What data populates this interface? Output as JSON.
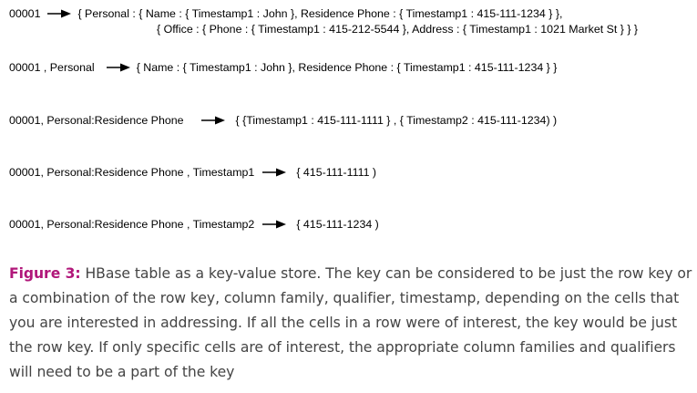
{
  "rows": [
    {
      "key": "00001",
      "value_line1": "{ Personal : { Name : { Timestamp1 : John }, Residence Phone : { Timestamp1 : 415-111-1234 } },",
      "value_line2": "{ Office : { Phone : { Timestamp1 : 415-212-5544 }, Address : { Timestamp1 : 1021 Market St } } }"
    },
    {
      "key": "00001 , Personal",
      "value_line1": "{ Name : { Timestamp1 : John }, Residence Phone : { Timestamp1 : 415-111-1234 } }"
    },
    {
      "key": "00001, Personal:Residence Phone",
      "value_line1": "{ {Timestamp1 : 415-111-1111 } , { Timestamp2 : 415-111-1234) )"
    },
    {
      "key": "00001, Personal:Residence Phone , Timestamp1",
      "value_line1": "{ 415-111-1111 )"
    },
    {
      "key": "00001, Personal:Residence Phone , Timestamp2",
      "value_line1": "{ 415-111-1234 )"
    }
  ],
  "caption": {
    "label": "Figure 3:",
    "text": " HBase table as a key-value store. The key can be considered to be just the row key or a combination of the row key, column family, qualifier, timestamp, depending on the cells that you are interested in addressing. If all the cells in a row were of interest, the key would be just the row key. If only specific cells are of interest, the appropriate column families and qualifiers will need to be a part of the key"
  },
  "colors": {
    "figure_label": "#b1177a",
    "caption_text": "#444444",
    "diagram_text": "#000000"
  },
  "icons": {
    "arrow": "right-arrow-icon"
  }
}
